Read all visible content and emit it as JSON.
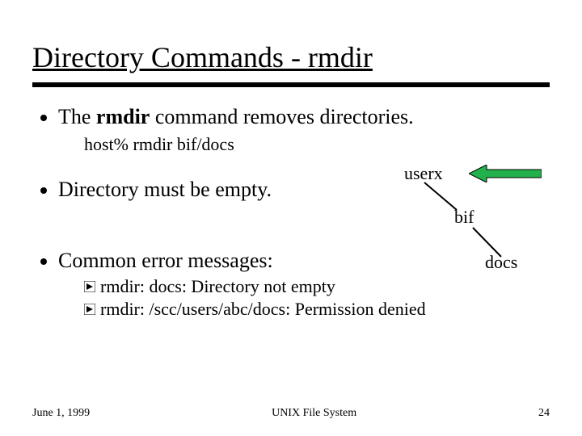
{
  "title": "Directory Commands - rmdir",
  "bullets": {
    "b1_pre": "The ",
    "b1_bold": "rmdir",
    "b1_post": " command removes directories.",
    "cmd": "host%  rmdir  bif/docs",
    "b2": "Directory must be empty.",
    "b3": "Common error messages:"
  },
  "errors": {
    "e1": "rmdir: docs: Directory not empty",
    "e2": "rmdir: /scc/users/abc/docs: Permission denied"
  },
  "tree": {
    "userx": "userx",
    "bif": "bif",
    "docs": "docs"
  },
  "footer": {
    "date": "June 1, 1999",
    "center": "UNIX File System",
    "page": "24"
  }
}
